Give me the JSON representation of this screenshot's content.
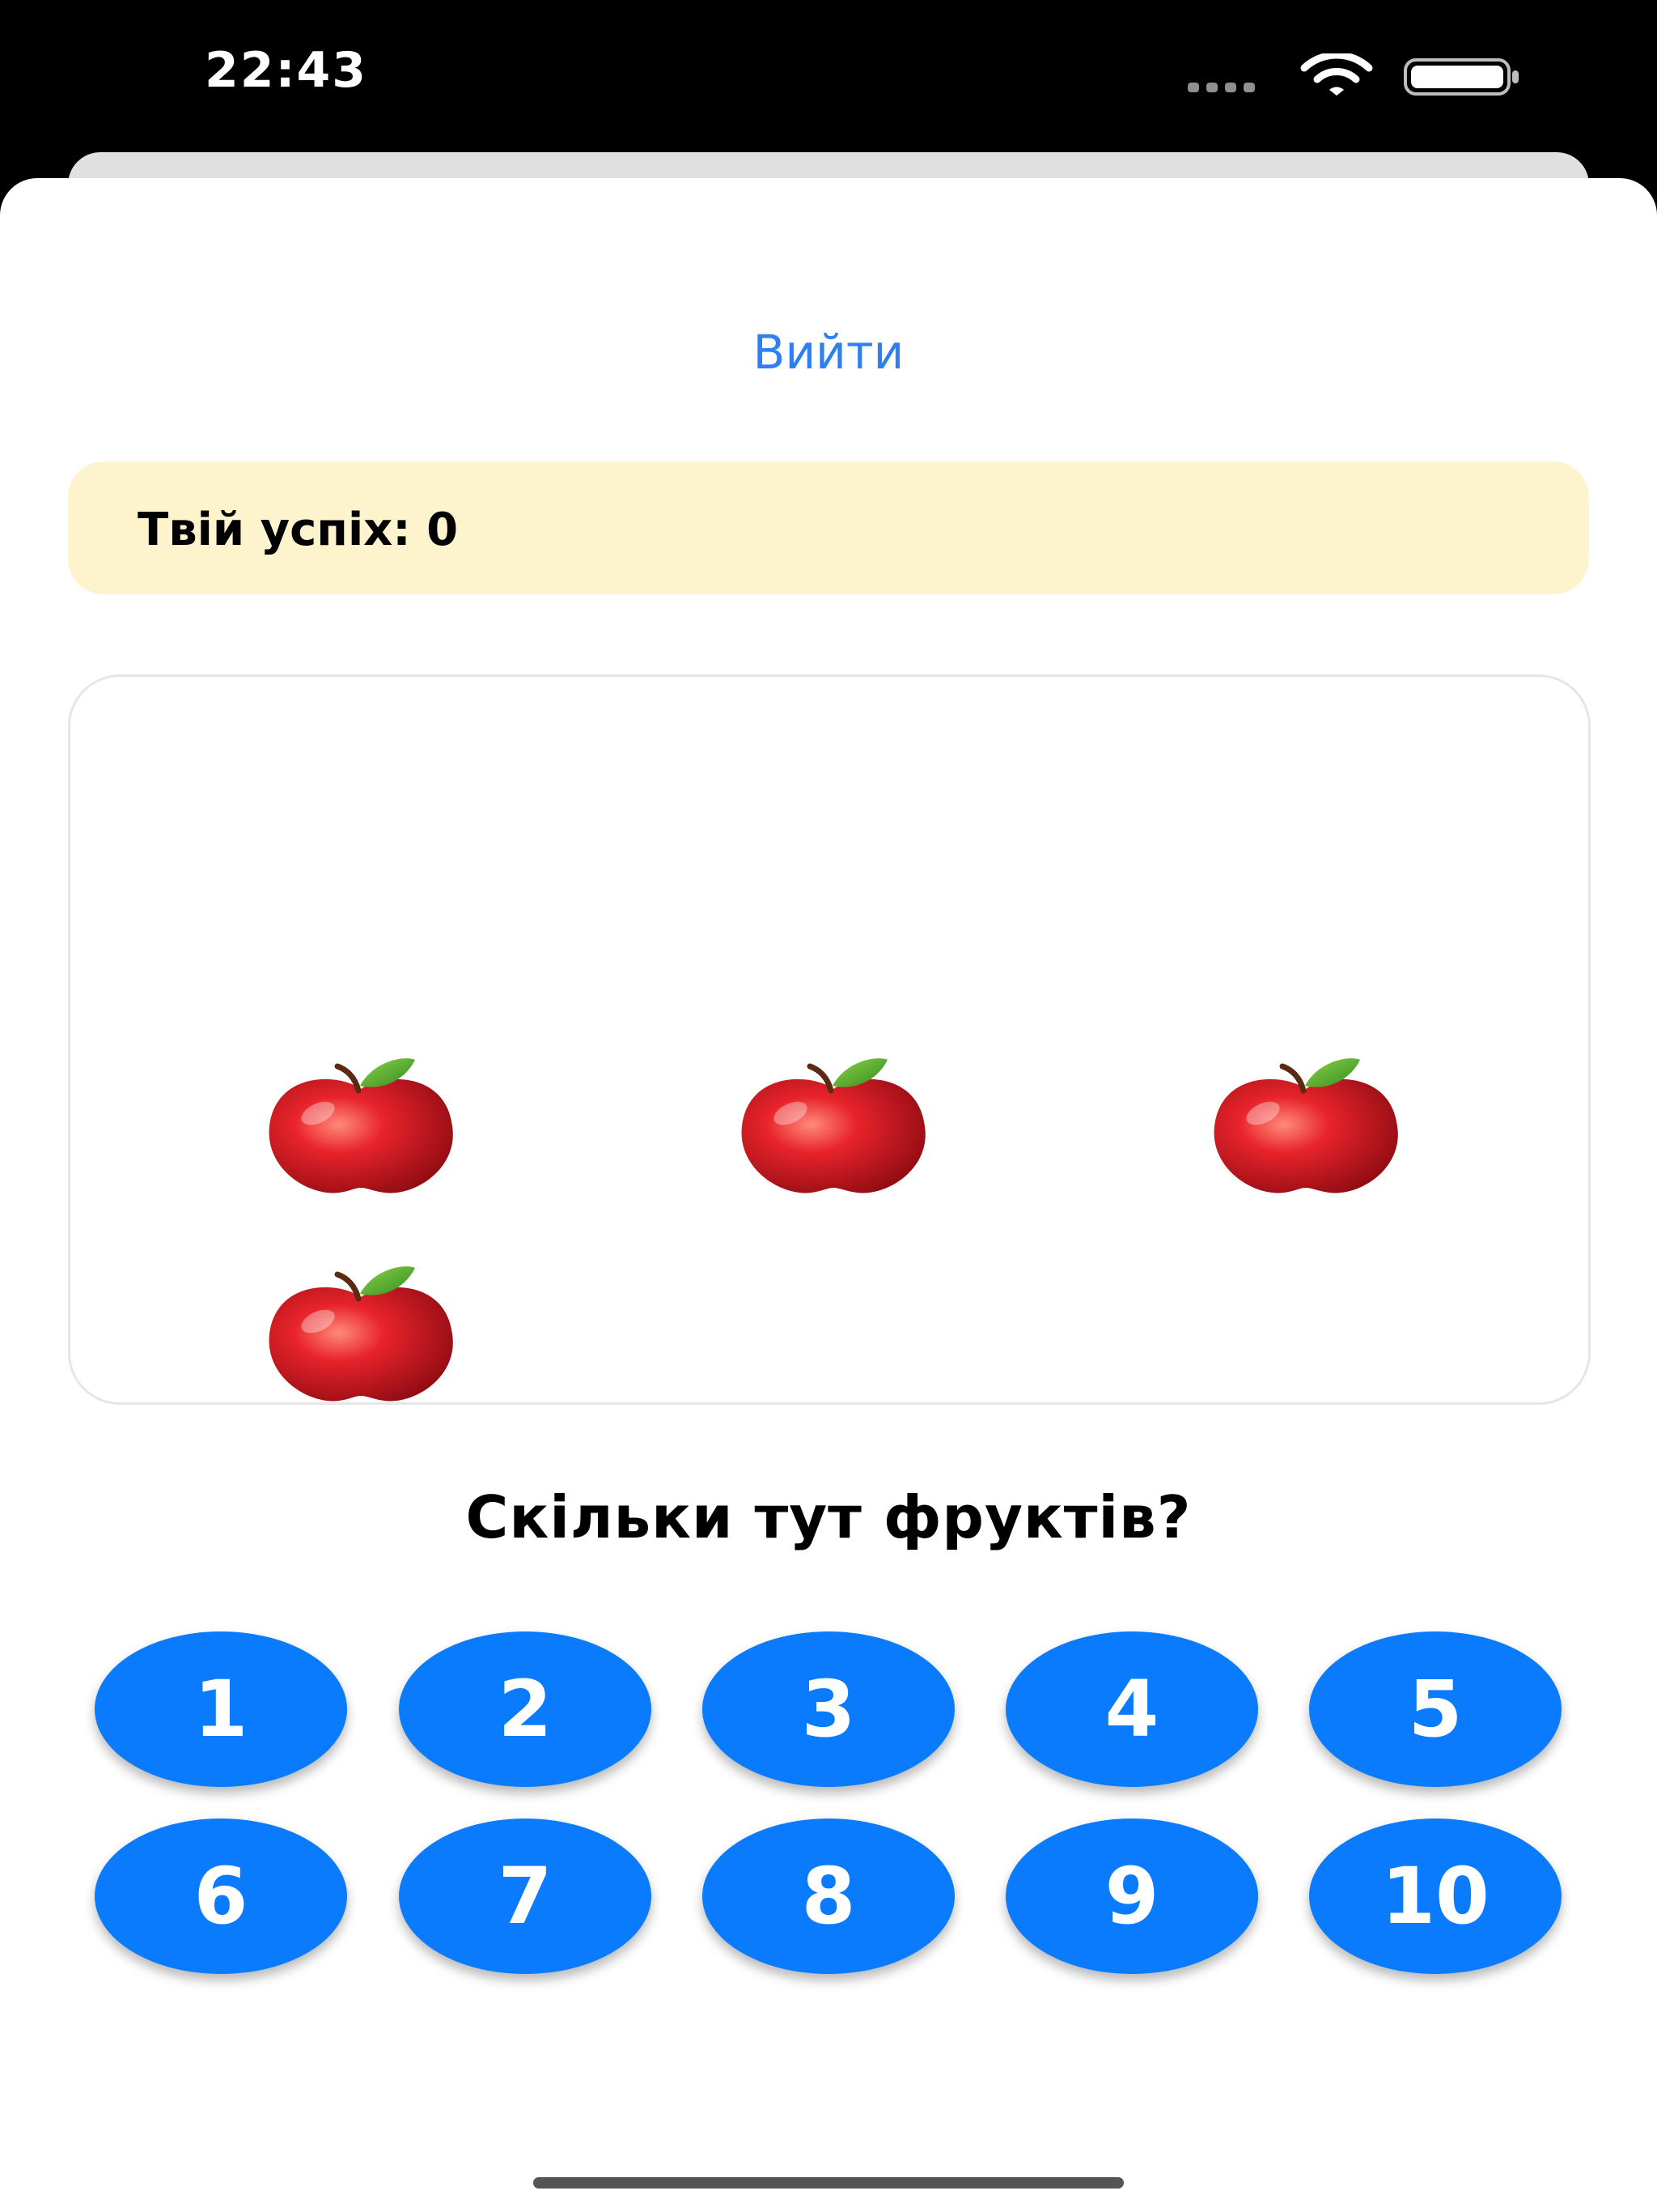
{
  "status_bar": {
    "time": "22:43",
    "icons": [
      "cellular-dots-icon",
      "wifi-icon",
      "battery-icon"
    ]
  },
  "header": {
    "exit_label": "Вийти",
    "link_color": "#2f7ff2"
  },
  "score": {
    "label": "Твій успіх: 0",
    "background": "#fdf4cd"
  },
  "fruits": {
    "name": "apple-icon",
    "count_shown": 4
  },
  "question": "Скільки тут фруктів?",
  "answers": [
    "1",
    "2",
    "3",
    "4",
    "5",
    "6",
    "7",
    "8",
    "9",
    "10"
  ],
  "colors": {
    "answer_button": "#0a7bfd",
    "answer_text": "#ffffff"
  }
}
